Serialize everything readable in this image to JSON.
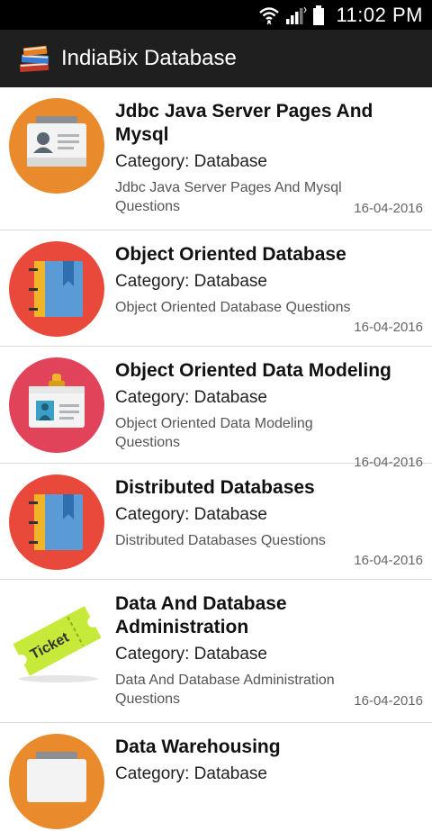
{
  "status_bar": {
    "time": "11:02 PM"
  },
  "app_bar": {
    "title": "IndiaBix Database"
  },
  "items": [
    {
      "title": "Jdbc Java Server Pages And Mysql",
      "category": "Category: Database",
      "description": "Jdbc Java Server Pages And Mysql Questions",
      "date": "16-04-2016",
      "icon": "id-card-icon"
    },
    {
      "title": "Object Oriented Database",
      "category": "Category: Database",
      "description": "Object Oriented Database Questions",
      "date": "16-04-2016",
      "icon": "notebook-icon"
    },
    {
      "title": "Object Oriented Data Modeling",
      "category": "Category: Database",
      "description": "Object Oriented Data Modeling Questions",
      "date": "16-04-2016",
      "icon": "badge-icon"
    },
    {
      "title": "Distributed Databases",
      "category": "Category: Database",
      "description": "Distributed Databases Questions",
      "date": "16-04-2016",
      "icon": "notebook-icon"
    },
    {
      "title": "Data And Database Administration",
      "category": "Category: Database",
      "description": "Data And Database Administration Questions",
      "date": "16-04-2016",
      "icon": "ticket-icon",
      "icon_text": "Ticket"
    },
    {
      "title": "Data Warehousing",
      "category": "Category: Database",
      "icon": "id-card-icon"
    }
  ],
  "colors": {
    "status_bar_bg": "#000000",
    "app_bar_bg": "#1f1f1f",
    "orange_icon": "#e98a2c",
    "red_icon": "#e8493a",
    "pink_icon": "#e0435a",
    "ticket_green": "#c6ea3a"
  }
}
